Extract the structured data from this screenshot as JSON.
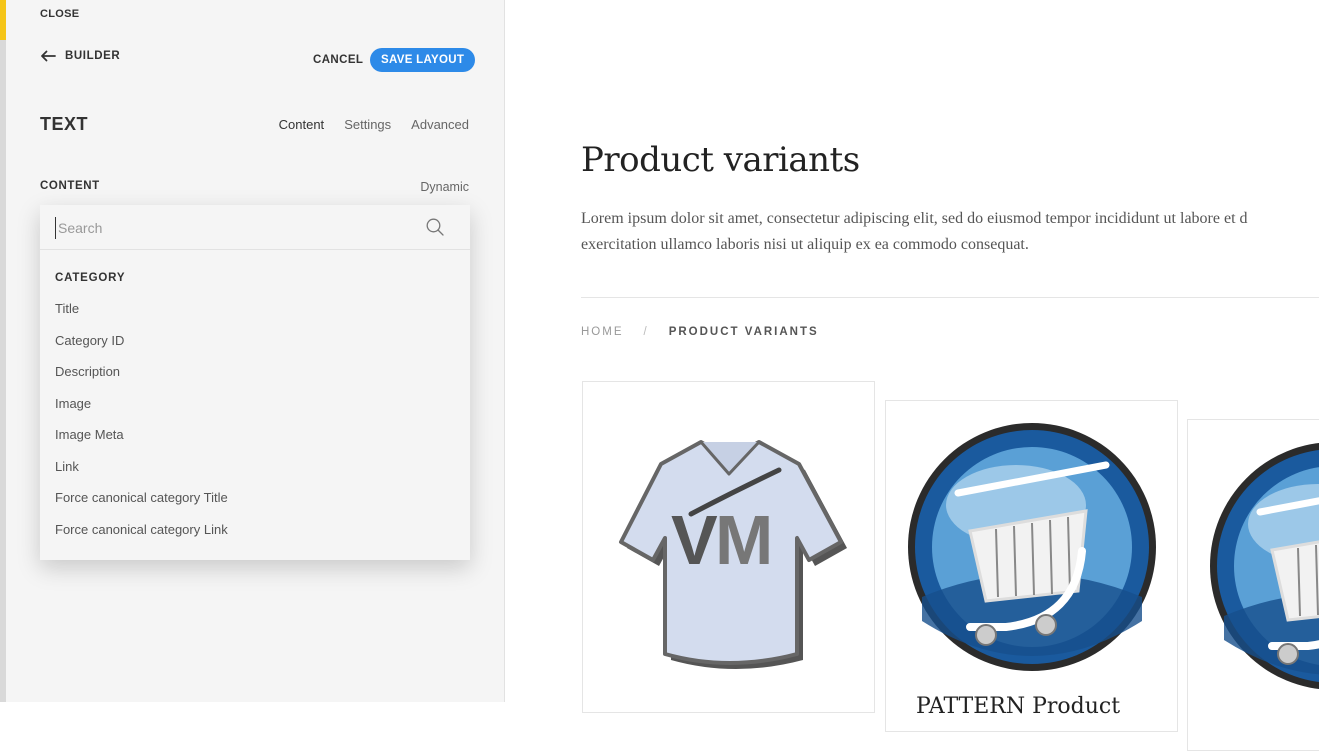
{
  "panel": {
    "close_label": "CLOSE",
    "builder_label": "BUILDER",
    "cancel_label": "CANCEL",
    "save_label": "SAVE LAYOUT",
    "element_title": "TEXT",
    "tabs": [
      {
        "label": "Content",
        "active": true
      },
      {
        "label": "Settings",
        "active": false
      },
      {
        "label": "Advanced",
        "active": false
      }
    ],
    "content_label": "CONTENT",
    "dynamic_label": "Dynamic"
  },
  "dropdown": {
    "search_placeholder": "Search",
    "category_heading": "CATEGORY",
    "options": [
      "Title",
      "Category ID",
      "Description",
      "Image",
      "Image Meta",
      "Link",
      "Force canonical category Title",
      "Force canonical category Link"
    ]
  },
  "page": {
    "title": "Product variants",
    "intro_line1": "Lorem ipsum dolor sit amet, consectetur adipiscing elit, sed do eiusmod tempor incididunt ut labore et d",
    "intro_line2": "exercitation ullamco laboris nisi ut aliquip ex ea commodo consequat.",
    "breadcrumb": {
      "home": "HOME",
      "separator": "/",
      "current": "PRODUCT VARIANTS"
    },
    "products": [
      {
        "image": "tshirt-vm-logo"
      },
      {
        "image": "shopping-cart-logo",
        "partial_title": "PATTERN Product"
      },
      {
        "image": "shopping-cart-logo"
      }
    ]
  },
  "colors": {
    "accent": "#2d8ae8",
    "panel_bg": "#f5f5f5",
    "cart_blue": "#1a5a9e"
  }
}
